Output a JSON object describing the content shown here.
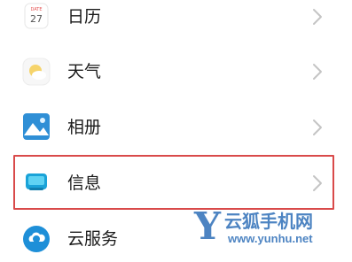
{
  "settings_list": {
    "items": [
      {
        "label": "日历",
        "icon": "calendar-icon",
        "icon_text": "27",
        "icon_badge": "DATE"
      },
      {
        "label": "天气",
        "icon": "weather-icon"
      },
      {
        "label": "相册",
        "icon": "gallery-icon"
      },
      {
        "label": "信息",
        "icon": "messages-icon"
      },
      {
        "label": "云服务",
        "icon": "cloud-service-icon"
      }
    ]
  },
  "highlight": {
    "target": "信息",
    "color": "#d94a4a"
  },
  "watermark": {
    "logo_letter": "Y",
    "title": "云狐手机网",
    "url": "www.yunhu.net",
    "color": "#2f6fb8"
  },
  "colors": {
    "accent": "#1aa3d8",
    "chevron": "#c4c4c4",
    "text": "#1a1a1a"
  }
}
